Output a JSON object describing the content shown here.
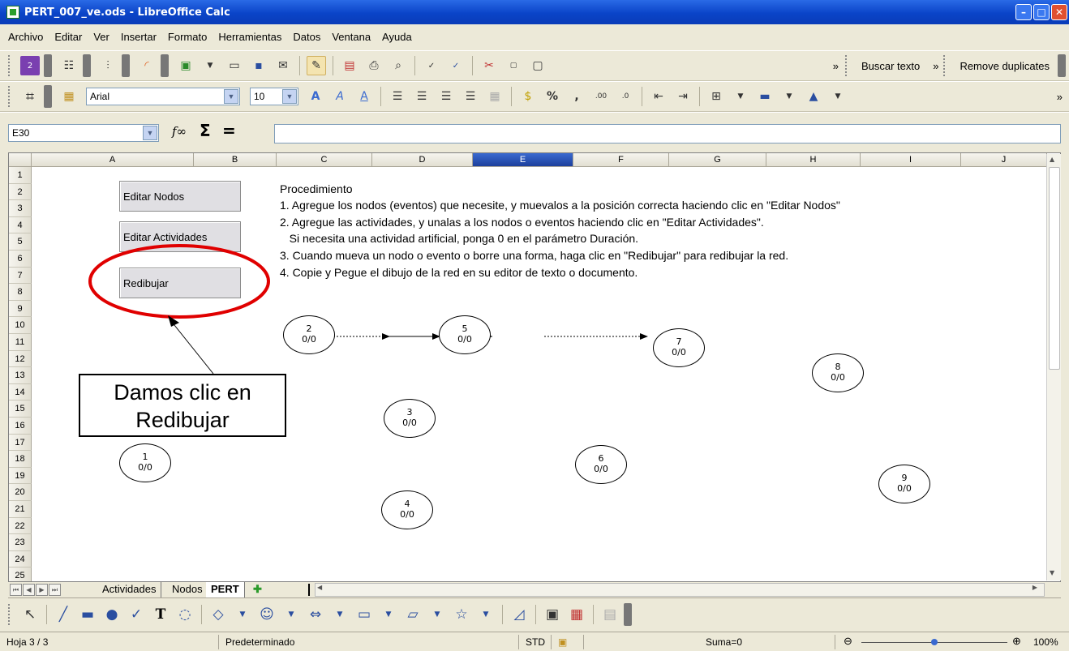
{
  "window": {
    "title": "PERT_007_ve.ods - LibreOffice Calc"
  },
  "menu": [
    "Archivo",
    "Editar",
    "Ver",
    "Insertar",
    "Formato",
    "Herramientas",
    "Datos",
    "Ventana",
    "Ayuda"
  ],
  "toolbar": {
    "find_label": "Buscar texto",
    "remove_dup_label": "Remove duplicates"
  },
  "formatting": {
    "font_name": "Arial",
    "font_size": "10"
  },
  "formula_bar": {
    "cell_ref": "E30",
    "formula": ""
  },
  "sheet": {
    "columns": [
      "A",
      "B",
      "C",
      "D",
      "E",
      "F",
      "G",
      "H",
      "I",
      "J"
    ],
    "selected_column": "E",
    "rows": [
      "1",
      "2",
      "3",
      "4",
      "5",
      "6",
      "7",
      "8",
      "9",
      "10",
      "11",
      "12",
      "13",
      "14",
      "15",
      "16",
      "17",
      "18",
      "19",
      "20",
      "21",
      "22",
      "23",
      "24",
      "25"
    ]
  },
  "buttons": {
    "edit_nodes": "Editar Nodos",
    "edit_activities": "Editar Actividades",
    "redraw": "Redibujar"
  },
  "procedure": {
    "title": "Procedimiento",
    "lines": [
      "1. Agregue los nodos (eventos) que necesite, y muevalos a la posición correcta haciendo clic en \"Editar Nodos\"",
      "2. Agregue las actividades, y unalas a los nodos o eventos haciendo clic en  \"Editar Actividades\".",
      "   Si necesita una actividad artificial, ponga 0 en el parámetro Duración.",
      "3. Cuando mueva un nodo o evento o borre una forma, haga clic en \"Redibujar\" para redibujar la red.",
      "4. Copie y Pegue el dibujo de la red en su editor de texto o documento."
    ]
  },
  "nodes": [
    {
      "id": "1",
      "value": "0/0"
    },
    {
      "id": "2",
      "value": "0/0"
    },
    {
      "id": "3",
      "value": "0/0"
    },
    {
      "id": "4",
      "value": "0/0"
    },
    {
      "id": "5",
      "value": "0/0"
    },
    {
      "id": "6",
      "value": "0/0"
    },
    {
      "id": "7",
      "value": "0/0"
    },
    {
      "id": "8",
      "value": "0/0"
    },
    {
      "id": "9",
      "value": "0/0"
    }
  ],
  "annotation": {
    "line1": "Damos clic en",
    "line2": "Redibujar",
    "highlight_color": "#e00000"
  },
  "tabs": [
    {
      "label": "Actividades",
      "active": false
    },
    {
      "label": "Nodos",
      "active": false
    },
    {
      "label": "PERT",
      "active": true
    }
  ],
  "status": {
    "sheet": "Hoja 3 / 3",
    "style": "Predeterminado",
    "mode": "STD",
    "sum": "Suma=0",
    "zoom": "100%"
  }
}
